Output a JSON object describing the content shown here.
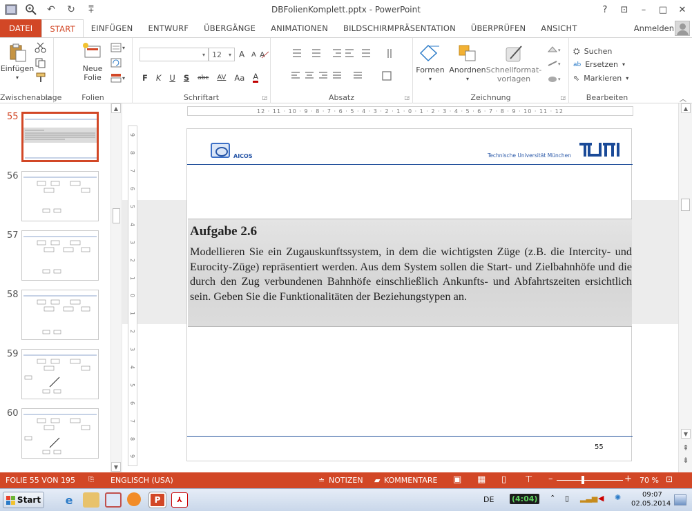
{
  "window": {
    "title": "DBFolienKomplett.pptx - PowerPoint",
    "help": "?",
    "ribbon_display": "⊡",
    "minimize": "–",
    "maximize": "□",
    "close": "✕"
  },
  "qat": {
    "undo": "↶",
    "redo": "↻",
    "customize": "⩱"
  },
  "tabs": {
    "file": "DATEI",
    "items": [
      "START",
      "EINFÜGEN",
      "ENTWURF",
      "ÜBERGÄNGE",
      "ANIMATIONEN",
      "BILDSCHIRMPRÄSENTATION",
      "ÜBERPRÜFEN",
      "ANSICHT"
    ],
    "active": "START",
    "signin": "Anmelden"
  },
  "ribbon": {
    "clipboard": {
      "paste": "Einfügen",
      "label": "Zwischenablage"
    },
    "slides": {
      "new_slide_1": "Neue",
      "new_slide_2": "Folie",
      "label": "Folien"
    },
    "font": {
      "font_name": "",
      "font_size": "12",
      "label": "Schriftart",
      "bold": "F",
      "italic": "K",
      "underline": "U",
      "shadow": "S",
      "strike": "abc",
      "spacing": "AV",
      "case": "Aa",
      "color": "A",
      "grow": "A",
      "shrink": "A"
    },
    "paragraph": {
      "label": "Absatz"
    },
    "drawing": {
      "shapes": "Formen",
      "arrange": "Anordnen",
      "quickstyles_1": "Schnellformat-",
      "quickstyles_2": "vorlagen",
      "label": "Zeichnung"
    },
    "editing": {
      "find": "Suchen",
      "replace": "Ersetzen",
      "select": "Markieren",
      "label": "Bearbeiten"
    }
  },
  "thumbnails": [
    {
      "num": "55",
      "selected": true
    },
    {
      "num": "56",
      "selected": false
    },
    {
      "num": "57",
      "selected": false
    },
    {
      "num": "58",
      "selected": false
    },
    {
      "num": "59",
      "selected": false
    },
    {
      "num": "60",
      "selected": false
    }
  ],
  "rulers": {
    "horizontal": "12 · 11 · 10 · 9 · 8 · 7 · 6 · 5 · 4 · 3 · 2 · 1 · 0 · 1 · 2 · 3 · 4 · 5 · 6 · 7 · 8 · 9 · 10 · 11 · 12",
    "vertical": [
      "9",
      "8",
      "7",
      "6",
      "5",
      "4",
      "3",
      "2",
      "1",
      "0",
      "1",
      "2",
      "3",
      "4",
      "5",
      "6",
      "7",
      "8",
      "9"
    ]
  },
  "slide": {
    "org": "AICOS",
    "university": "Technische Universität München",
    "heading": "Aufgabe 2.6",
    "body": "Modellieren Sie ein Zugauskunftssystem, in dem die wichtigsten Züge (z.B. die Intercity- und Eurocity-Züge) repräsentiert werden. Aus dem System sollen die Start- und Zielbahnhöfe und die durch den Zug verbundenen Bahnhöfe einschließlich Ankunfts- und Abfahrtszeiten ersichtlich sein. Geben Sie die Funktionalitäten der Beziehungstypen an.",
    "page_number": "55"
  },
  "status": {
    "slide_counter": "FOLIE 55 VON 195",
    "language": "ENGLISCH (USA)",
    "notes": "NOTIZEN",
    "comments": "KOMMENTARE",
    "zoom": "70 %",
    "zoom_fraction": 0.4
  },
  "taskbar": {
    "start": "Start",
    "lang": "DE",
    "battery": "(4:04)",
    "time": "09:07",
    "date": "02.05.2014"
  }
}
